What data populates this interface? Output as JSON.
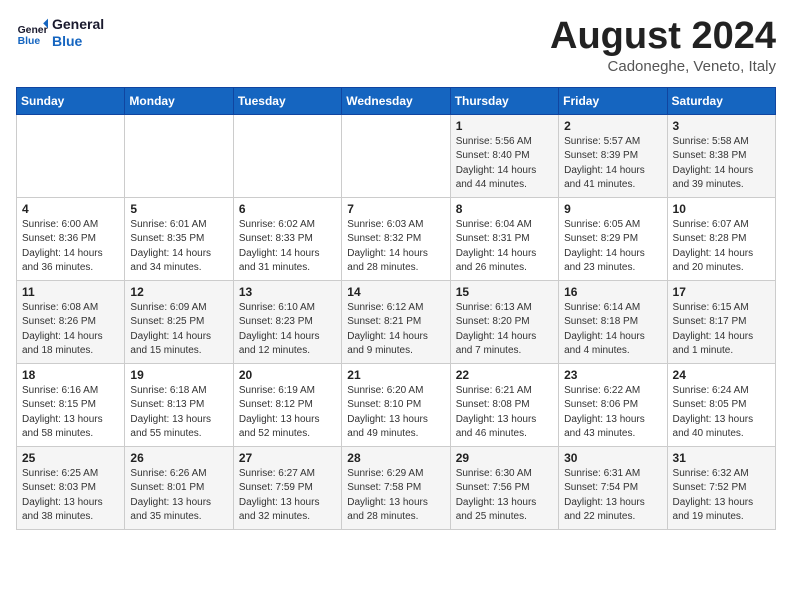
{
  "header": {
    "logo_line1": "General",
    "logo_line2": "Blue",
    "month": "August 2024",
    "location": "Cadoneghe, Veneto, Italy"
  },
  "weekdays": [
    "Sunday",
    "Monday",
    "Tuesday",
    "Wednesday",
    "Thursday",
    "Friday",
    "Saturday"
  ],
  "weeks": [
    [
      {
        "day": "",
        "detail": ""
      },
      {
        "day": "",
        "detail": ""
      },
      {
        "day": "",
        "detail": ""
      },
      {
        "day": "",
        "detail": ""
      },
      {
        "day": "1",
        "detail": "Sunrise: 5:56 AM\nSunset: 8:40 PM\nDaylight: 14 hours\nand 44 minutes."
      },
      {
        "day": "2",
        "detail": "Sunrise: 5:57 AM\nSunset: 8:39 PM\nDaylight: 14 hours\nand 41 minutes."
      },
      {
        "day": "3",
        "detail": "Sunrise: 5:58 AM\nSunset: 8:38 PM\nDaylight: 14 hours\nand 39 minutes."
      }
    ],
    [
      {
        "day": "4",
        "detail": "Sunrise: 6:00 AM\nSunset: 8:36 PM\nDaylight: 14 hours\nand 36 minutes."
      },
      {
        "day": "5",
        "detail": "Sunrise: 6:01 AM\nSunset: 8:35 PM\nDaylight: 14 hours\nand 34 minutes."
      },
      {
        "day": "6",
        "detail": "Sunrise: 6:02 AM\nSunset: 8:33 PM\nDaylight: 14 hours\nand 31 minutes."
      },
      {
        "day": "7",
        "detail": "Sunrise: 6:03 AM\nSunset: 8:32 PM\nDaylight: 14 hours\nand 28 minutes."
      },
      {
        "day": "8",
        "detail": "Sunrise: 6:04 AM\nSunset: 8:31 PM\nDaylight: 14 hours\nand 26 minutes."
      },
      {
        "day": "9",
        "detail": "Sunrise: 6:05 AM\nSunset: 8:29 PM\nDaylight: 14 hours\nand 23 minutes."
      },
      {
        "day": "10",
        "detail": "Sunrise: 6:07 AM\nSunset: 8:28 PM\nDaylight: 14 hours\nand 20 minutes."
      }
    ],
    [
      {
        "day": "11",
        "detail": "Sunrise: 6:08 AM\nSunset: 8:26 PM\nDaylight: 14 hours\nand 18 minutes."
      },
      {
        "day": "12",
        "detail": "Sunrise: 6:09 AM\nSunset: 8:25 PM\nDaylight: 14 hours\nand 15 minutes."
      },
      {
        "day": "13",
        "detail": "Sunrise: 6:10 AM\nSunset: 8:23 PM\nDaylight: 14 hours\nand 12 minutes."
      },
      {
        "day": "14",
        "detail": "Sunrise: 6:12 AM\nSunset: 8:21 PM\nDaylight: 14 hours\nand 9 minutes."
      },
      {
        "day": "15",
        "detail": "Sunrise: 6:13 AM\nSunset: 8:20 PM\nDaylight: 14 hours\nand 7 minutes."
      },
      {
        "day": "16",
        "detail": "Sunrise: 6:14 AM\nSunset: 8:18 PM\nDaylight: 14 hours\nand 4 minutes."
      },
      {
        "day": "17",
        "detail": "Sunrise: 6:15 AM\nSunset: 8:17 PM\nDaylight: 14 hours\nand 1 minute."
      }
    ],
    [
      {
        "day": "18",
        "detail": "Sunrise: 6:16 AM\nSunset: 8:15 PM\nDaylight: 13 hours\nand 58 minutes."
      },
      {
        "day": "19",
        "detail": "Sunrise: 6:18 AM\nSunset: 8:13 PM\nDaylight: 13 hours\nand 55 minutes."
      },
      {
        "day": "20",
        "detail": "Sunrise: 6:19 AM\nSunset: 8:12 PM\nDaylight: 13 hours\nand 52 minutes."
      },
      {
        "day": "21",
        "detail": "Sunrise: 6:20 AM\nSunset: 8:10 PM\nDaylight: 13 hours\nand 49 minutes."
      },
      {
        "day": "22",
        "detail": "Sunrise: 6:21 AM\nSunset: 8:08 PM\nDaylight: 13 hours\nand 46 minutes."
      },
      {
        "day": "23",
        "detail": "Sunrise: 6:22 AM\nSunset: 8:06 PM\nDaylight: 13 hours\nand 43 minutes."
      },
      {
        "day": "24",
        "detail": "Sunrise: 6:24 AM\nSunset: 8:05 PM\nDaylight: 13 hours\nand 40 minutes."
      }
    ],
    [
      {
        "day": "25",
        "detail": "Sunrise: 6:25 AM\nSunset: 8:03 PM\nDaylight: 13 hours\nand 38 minutes."
      },
      {
        "day": "26",
        "detail": "Sunrise: 6:26 AM\nSunset: 8:01 PM\nDaylight: 13 hours\nand 35 minutes."
      },
      {
        "day": "27",
        "detail": "Sunrise: 6:27 AM\nSunset: 7:59 PM\nDaylight: 13 hours\nand 32 minutes."
      },
      {
        "day": "28",
        "detail": "Sunrise: 6:29 AM\nSunset: 7:58 PM\nDaylight: 13 hours\nand 28 minutes."
      },
      {
        "day": "29",
        "detail": "Sunrise: 6:30 AM\nSunset: 7:56 PM\nDaylight: 13 hours\nand 25 minutes."
      },
      {
        "day": "30",
        "detail": "Sunrise: 6:31 AM\nSunset: 7:54 PM\nDaylight: 13 hours\nand 22 minutes."
      },
      {
        "day": "31",
        "detail": "Sunrise: 6:32 AM\nSunset: 7:52 PM\nDaylight: 13 hours\nand 19 minutes."
      }
    ]
  ]
}
